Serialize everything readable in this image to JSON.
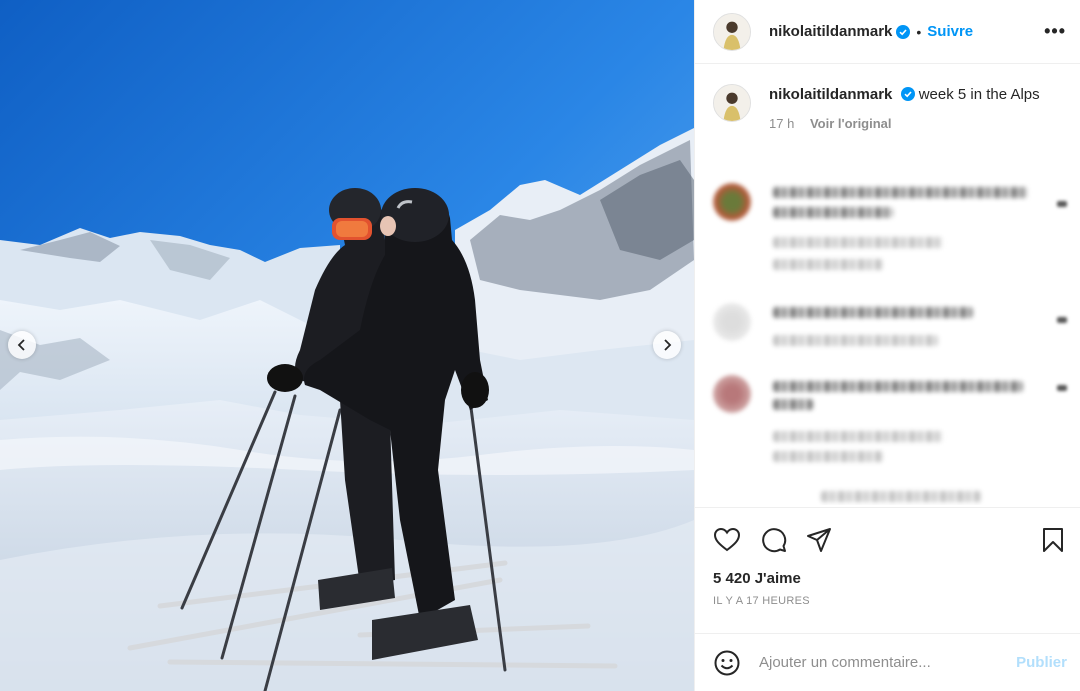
{
  "post": {
    "username": "nikolaitildanmark",
    "follow_label": "Suivre",
    "more_label": "•••",
    "dot": "•"
  },
  "caption": {
    "username": "nikolaitildanmark",
    "text": "week 5 in the Alps",
    "time": "17 h",
    "see_original": "Voir l'original"
  },
  "stats": {
    "likes": "5 420 J'aime",
    "time_ago": "IL Y A 17 HEURES"
  },
  "comment_box": {
    "placeholder": "Ajouter un commentaire...",
    "publish_label": "Publier"
  },
  "icons": {
    "like": "heart-icon",
    "comment": "comment-icon",
    "share": "share-icon",
    "save": "bookmark-icon",
    "emoji": "emoji-icon",
    "verified": "verified-badge-icon",
    "prev": "chevron-left-icon",
    "next": "chevron-right-icon"
  },
  "colors": {
    "accent": "#0095f6",
    "verified": "#0095f6",
    "muted": "#8e8e8e",
    "publish_disabled": "#b2dffc"
  }
}
